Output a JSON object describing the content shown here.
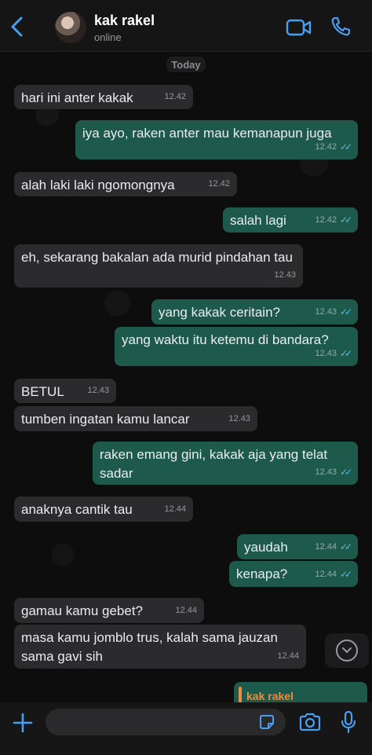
{
  "header": {
    "contact_name": "kak rakel",
    "status": "online"
  },
  "chat": {
    "date_label": "Today",
    "messages": [
      {
        "dir": "in",
        "text": "hari ini anter kakak",
        "time": "12.42"
      },
      {
        "dir": "out",
        "text": "iya ayo, raken anter mau kemanapun juga",
        "time": "12.42"
      },
      {
        "dir": "in",
        "text": "alah laki laki ngomongnya",
        "time": "12.42"
      },
      {
        "dir": "out",
        "text": "salah lagi",
        "time": "12.42"
      },
      {
        "dir": "in",
        "text": "eh, sekarang bakalan ada murid pindahan tau",
        "time": "12.43"
      },
      {
        "dir": "out",
        "text": "yang kakak ceritain?",
        "time": "12.43"
      },
      {
        "dir": "out",
        "text": "yang waktu itu ketemu di bandara?",
        "time": "12.43"
      },
      {
        "dir": "in",
        "text": "BETUL",
        "time": "12.43"
      },
      {
        "dir": "in",
        "text": "tumben ingatan kamu lancar",
        "time": "12.43"
      },
      {
        "dir": "out",
        "text": "raken emang gini, kakak aja yang telat sadar",
        "time": "12.43"
      },
      {
        "dir": "in",
        "text": "anaknya cantik tau",
        "time": "12.44"
      },
      {
        "dir": "out",
        "text": "yaudah",
        "time": "12.44"
      },
      {
        "dir": "out",
        "text": "kenapa?",
        "time": "12.44"
      },
      {
        "dir": "in",
        "text": "gamau kamu gebet?",
        "time": "12.44"
      },
      {
        "dir": "in",
        "text": "masa kamu jomblo trus, kalah sama jauzan sama gavi sih",
        "time": "12.44"
      }
    ],
    "reply_preview_name": "kak rakel"
  },
  "composer": {
    "placeholder": ""
  },
  "colors": {
    "incoming_bubble": "#2b2b2d",
    "outgoing_bubble": "#1e5a4c",
    "accent_blue": "#4a9ff5",
    "read_ticks": "#53bdeb"
  },
  "icons": [
    "back-chevron-icon",
    "video-call-icon",
    "phone-icon",
    "chevron-down-icon",
    "plus-icon",
    "sticker-icon",
    "camera-icon",
    "microphone-icon",
    "double-check-icon"
  ]
}
